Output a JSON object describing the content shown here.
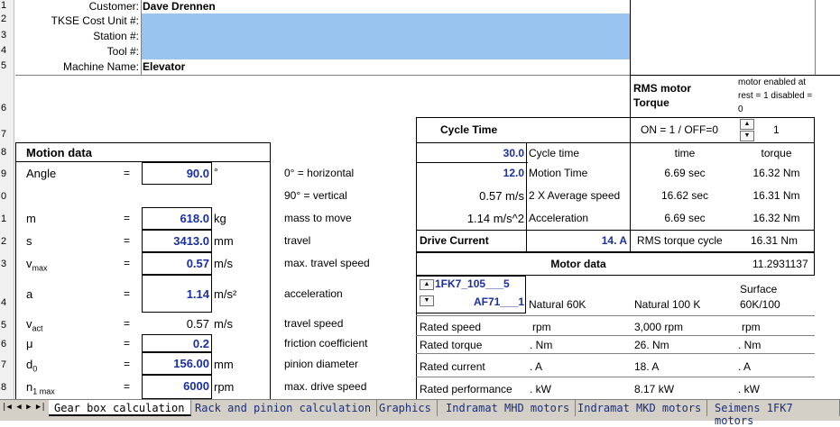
{
  "header": {
    "customer_label": "Customer:",
    "customer_value": "Dave Drennen",
    "cost_unit_label": "TKSE Cost Unit #:",
    "station_label": "Station #:",
    "tool_label": "Tool #:",
    "machine_label": "Machine Name:",
    "machine_value": "Elevator"
  },
  "row_numbers": [
    "1",
    "2",
    "3",
    "4",
    "5",
    "6",
    "7",
    "8",
    "9",
    "0",
    "1",
    "2",
    "3",
    "4",
    "5",
    "6",
    "7",
    "8"
  ],
  "rms": {
    "title": "RMS motor Torque",
    "note": "motor enabled at rest = 1 disabled = 0",
    "on_off_label": "ON = 1 / OFF=0",
    "on_off_value": "1"
  },
  "cycle": {
    "title": "Cycle Time",
    "time_header": "time",
    "torque_header": "torque",
    "rows": [
      {
        "value": "30.0",
        "label": "Cycle time",
        "time": "",
        "torque": ""
      },
      {
        "value": "12.0",
        "label": "Motion Time",
        "time": "6.69 sec",
        "torque": "16.32 Nm"
      },
      {
        "value": "0.57 m/s",
        "label": "2 X Average speed",
        "time": "16.62 sec",
        "torque": "16.31 Nm"
      },
      {
        "value": "1.14 m/s^2",
        "label": "Acceleration",
        "time": "6.69 sec",
        "torque": "16.32 Nm"
      }
    ],
    "drive_current_label": "Drive Current",
    "drive_current_value": "14. A",
    "rms_torque_label": "RMS torque cycle",
    "rms_torque_value": "16.31 Nm"
  },
  "motor": {
    "title": "Motor data",
    "value": "11.2931137",
    "model_line1": "1FK7_105___5",
    "model_line2": "AF71___1",
    "col1": "Natural 60K",
    "col2": "Natural 100 K",
    "col3_line1": "Surface",
    "col3_line2": "60K/100",
    "rows": [
      {
        "label": "Rated speed",
        "c1": "rpm",
        "c2": "3,000 rpm",
        "c3": "rpm"
      },
      {
        "label": "Rated torque",
        "c1": ". Nm",
        "c2": "26. Nm",
        "c3": ". Nm"
      },
      {
        "label": "Rated current",
        "c1": ". A",
        "c2": "18. A",
        "c3": ". A"
      },
      {
        "label": "Rated performance",
        "c1": ". kW",
        "c2": "8.17 kW",
        "c3": ". kW"
      }
    ]
  },
  "motion": {
    "title": "Motion data",
    "rows": [
      {
        "sym": "Angle",
        "sub": "",
        "eq": "=",
        "value": "90.0",
        "unit": "°",
        "desc": "0° = horizontal",
        "input": true
      },
      {
        "sym": "",
        "sub": "",
        "eq": "",
        "value": "",
        "unit": "",
        "desc": "90° = vertical",
        "input": false
      },
      {
        "sym": "m",
        "sub": "",
        "eq": "=",
        "value": "618.0",
        "unit": "kg",
        "desc": "mass to move",
        "input": true
      },
      {
        "sym": "s",
        "sub": "",
        "eq": "=",
        "value": "3413.0",
        "unit": "mm",
        "desc": "travel",
        "input": true
      },
      {
        "sym": "v",
        "sub": "max",
        "eq": "=",
        "value": "0.57",
        "unit": "m/s",
        "desc": "max. travel speed",
        "input": true
      },
      {
        "sym": "a",
        "sub": "",
        "eq": "=",
        "value": "1.14",
        "unit": "m/s²",
        "desc": "acceleration",
        "input": true
      },
      {
        "sym": "v",
        "sub": "act",
        "eq": "=",
        "value": "0.57",
        "unit": "m/s",
        "desc": "travel speed",
        "input": false
      },
      {
        "sym": "μ",
        "sub": "",
        "eq": "=",
        "value": "0.2",
        "unit": "",
        "desc": "friction coefficient",
        "input": true
      },
      {
        "sym": "d",
        "sub": "0",
        "eq": "=",
        "value": "156.00",
        "unit": "mm",
        "desc": "pinion diameter",
        "input": true
      },
      {
        "sym": "n",
        "sub": "1 max",
        "eq": "=",
        "value": "6000",
        "unit": "rpm",
        "desc": "max. drive speed",
        "input": true
      }
    ]
  },
  "sheet_tabs": [
    "Gear box calculation",
    "Rack and pinion calculation",
    "Graphics",
    "Indramat MHD motors",
    "Indramat MKD motors",
    "Seimens 1FK7 motors"
  ]
}
